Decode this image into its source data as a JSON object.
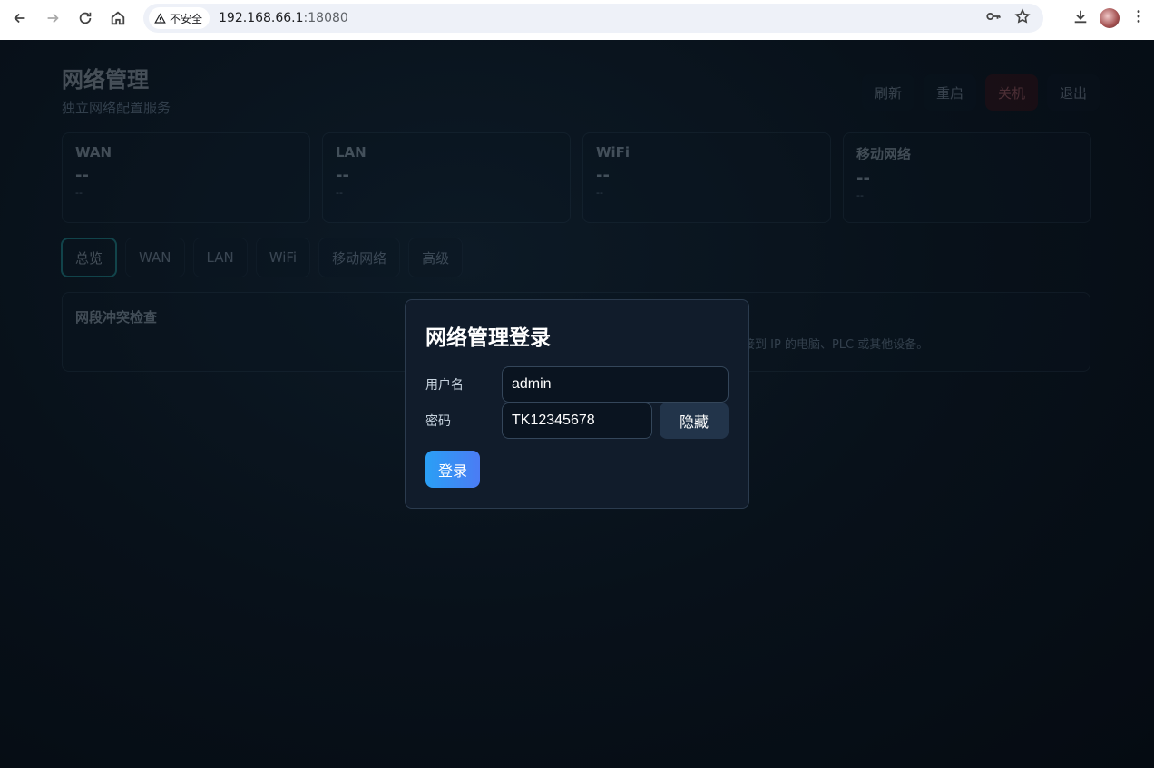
{
  "browser": {
    "security_label": "不安全",
    "url_host": "192.168.66.1",
    "url_port": ":18080"
  },
  "app": {
    "title": "网络管理",
    "subtitle": "独立网络配置服务",
    "actions": {
      "refresh": "刷新",
      "restart": "重启",
      "shutdown": "关机",
      "logout": "退出"
    },
    "cards": [
      {
        "title": "WAN",
        "value": "--",
        "sub": "--"
      },
      {
        "title": "LAN",
        "value": "--",
        "sub": "--"
      },
      {
        "title": "WiFi",
        "value": "--",
        "sub": "--"
      },
      {
        "title": "移动网络",
        "value": "--",
        "sub": "--"
      }
    ],
    "tabs": [
      "总览",
      "WAN",
      "LAN",
      "WiFi",
      "移动网络",
      "高级"
    ],
    "panel": {
      "title": "网段冲突检查",
      "desc_fragment": "接到 IP 的电脑、PLC 或其他设备。"
    }
  },
  "login": {
    "title": "网络管理登录",
    "username_label": "用户名",
    "username_value": "admin",
    "password_label": "密码",
    "password_value": "TK12345678",
    "toggle_label": "隐藏",
    "submit_label": "登录"
  }
}
